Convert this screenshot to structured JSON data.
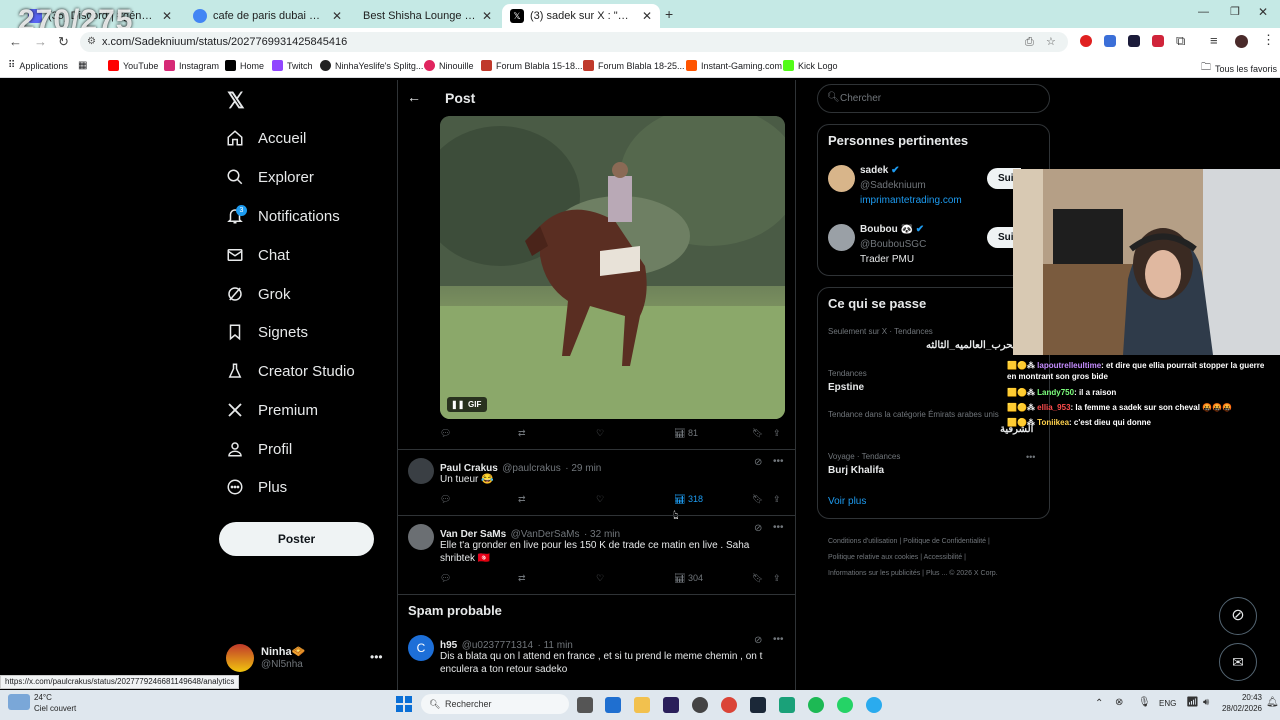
{
  "overlay_counter": "270/275",
  "tabs": [
    {
      "label": "(35) Discord | #général |",
      "icon_color": "#5865F2"
    },
    {
      "label": "cafe de paris dubai uae - Reche",
      "icon_color": "#4285F4"
    },
    {
      "label": "Best Shisha Lounge In Business",
      "icon_color": "#888888"
    },
    {
      "label": "(3) sadek sur X : \"On verra bien",
      "icon_color": "#000000"
    }
  ],
  "url": "x.com/Sadekniuum/status/2027769931425845416",
  "bookmarks": [
    {
      "label": "Applications",
      "color": "#555555"
    },
    {
      "label": "YouTube",
      "color": "#ff0000"
    },
    {
      "label": "Instagram",
      "color": "#d62976"
    },
    {
      "label": "Home",
      "color": "#000000"
    },
    {
      "label": "Twitch",
      "color": "#9146ff"
    },
    {
      "label": "NinhaYeslife's Splitg...",
      "color": "#222222"
    },
    {
      "label": "Ninouille",
      "color": "#e0245e"
    },
    {
      "label": "Forum Blabla 15-18...",
      "color": "#c0392b"
    },
    {
      "label": "Forum Blabla 18-25...",
      "color": "#c0392b"
    },
    {
      "label": "Instant-Gaming.com",
      "color": "#ff5400"
    },
    {
      "label": "Kick Logo",
      "color": "#53fc18"
    }
  ],
  "bookmarks_all": "Tous les favoris",
  "nav": [
    {
      "label": "Accueil",
      "icon": "home-icon"
    },
    {
      "label": "Explorer",
      "icon": "search-icon"
    },
    {
      "label": "Notifications",
      "icon": "bell-icon"
    },
    {
      "label": "Chat",
      "icon": "mail-icon"
    },
    {
      "label": "Grok",
      "icon": "grok-icon"
    },
    {
      "label": "Signets",
      "icon": "bookmark-icon"
    },
    {
      "label": "Creator Studio",
      "icon": "flask-icon"
    },
    {
      "label": "Premium",
      "icon": "x-icon"
    },
    {
      "label": "Profil",
      "icon": "person-icon"
    },
    {
      "label": "Plus",
      "icon": "more-circle-icon"
    }
  ],
  "notif_count": "3",
  "post_button": "Poster",
  "account": {
    "name": "Ninha🧇",
    "handle": "@Nl5nha"
  },
  "header_title": "Post",
  "gif_label": "GIF",
  "main_views": "81",
  "replies": [
    {
      "name": "Paul Crakus",
      "handle": "@paulcrakus",
      "time": "· 29 min",
      "text": "Un tueur 😂",
      "views": "318"
    },
    {
      "name": "Van Der SaMs",
      "handle": "@VanDerSaMs",
      "time": "· 32 min",
      "text": "Elle t'a gronder en live pour les 150 K de trade ce matin en live . Saha shribtek 🇹🇳",
      "views": "304"
    }
  ],
  "spam_heading": "Spam probable",
  "spam_reply": {
    "name": "h95",
    "handle": "@u0237771314",
    "time": "· 11 min",
    "avatar_letter": "C",
    "text": "Dis a  blata  qu on l attend en france , et si tu prend le meme chemin , on t enculera a ton retour sadeko"
  },
  "search_placeholder": "Chercher",
  "relevant": {
    "title": "Personnes pertinentes",
    "people": [
      {
        "name": "sadek",
        "handle": "@Sadekniuum",
        "bio": "imprimantetrading.com",
        "follow": "Sui"
      },
      {
        "name": "Boubou 🐼",
        "handle": "@BoubouSGC",
        "bio": "Trader PMU",
        "follow": "Sui"
      }
    ]
  },
  "trends": {
    "title": "Ce qui se passe",
    "items": [
      {
        "context": "Seulement sur X · Tendances",
        "name": "الحرب_العالميه_الثالثه"
      },
      {
        "context": "Tendances",
        "name": "Epstine"
      },
      {
        "context": "Tendance dans la catégorie Émirats arabes unis",
        "name": "الشرقية"
      },
      {
        "context": "Voyage · Tendances",
        "name": "Burj Khalifa"
      }
    ],
    "more": "Voir plus"
  },
  "footer_links": [
    "Conditions d'utilisation",
    "Politique de Confidentialité",
    "Politique relative aux cookies",
    "Accessibilité",
    "Informations sur les publicités",
    "Plus ...",
    "© 2026 X Corp."
  ],
  "chat": [
    {
      "user": "lapoutrelleultime",
      "msg": ": et dire que ellia pourrait stopper la guerre en montrant son gros bide",
      "color": "#c58cff"
    },
    {
      "user": "Landy750",
      "msg": ": il a raison",
      "color": "#7dff7d"
    },
    {
      "user": "ellia_953",
      "msg": ": la femme a sadek sur son cheval 🤬🤬🤬",
      "color": "#ff4d4d"
    },
    {
      "user": "Toniikea",
      "msg": ": c'est dieu qui donne",
      "color": "#ffd24d"
    }
  ],
  "status_link": "https://x.com/paulcrakus/status/2027779246681149648/analytics",
  "weather": {
    "temp": "24°C",
    "desc": "Ciel couvert"
  },
  "taskbar_search": "Rechercher",
  "tray": {
    "lang": "ENG",
    "time": "20:43",
    "date": "28/02/2026"
  }
}
